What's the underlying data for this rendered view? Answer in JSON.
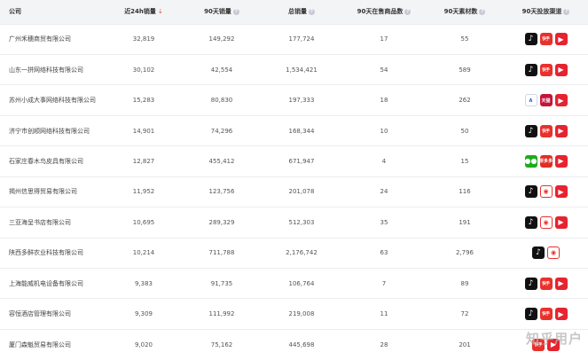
{
  "table": {
    "headers": [
      "公司",
      "近24h销量",
      "90天销量",
      "总销量",
      "90天在售商品数",
      "90天素材数",
      "90天投放渠道"
    ],
    "rows": [
      {
        "company": "广州禾穗商贸有限公司",
        "sales_24h": "32,819",
        "sales_90d": "149,292",
        "sales_total": "177,724",
        "items_90d": "17",
        "materials_90d": "55",
        "channels": [
          "douyin",
          "kuaishou",
          "kuaibao"
        ]
      },
      {
        "company": "山东一拼网络科技有限公司",
        "sales_24h": "30,102",
        "sales_90d": "42,554",
        "sales_total": "1,534,421",
        "items_90d": "54",
        "materials_90d": "589",
        "channels": [
          "douyin",
          "kuaishou",
          "kuaibao"
        ]
      },
      {
        "company": "苏州小成大事网络科技有限公司",
        "sales_24h": "15,283",
        "sales_90d": "80,830",
        "sales_total": "197,333",
        "items_90d": "18",
        "materials_90d": "262",
        "channels": [
          "lvye",
          "tmall",
          "kuaibao"
        ]
      },
      {
        "company": "济宁市创顺网络科技有限公司",
        "sales_24h": "14,901",
        "sales_90d": "74,296",
        "sales_total": "168,344",
        "items_90d": "10",
        "materials_90d": "50",
        "channels": [
          "douyin",
          "kuaishou",
          "kuaibao"
        ]
      },
      {
        "company": "石家庄春木鸟皮具有限公司",
        "sales_24h": "12,827",
        "sales_90d": "455,412",
        "sales_total": "671,947",
        "items_90d": "4",
        "materials_90d": "15",
        "channels": [
          "wechat",
          "pinduoduo",
          "kuaibao"
        ]
      },
      {
        "company": "揭州信思得贸易有限公司",
        "sales_24h": "11,952",
        "sales_90d": "123,756",
        "sales_total": "201,078",
        "items_90d": "24",
        "materials_90d": "116",
        "channels": [
          "douyin",
          "yangtao",
          "kuaibao"
        ]
      },
      {
        "company": "三亚海呈书店有限公司",
        "sales_24h": "10,695",
        "sales_90d": "289,329",
        "sales_total": "512,303",
        "items_90d": "35",
        "materials_90d": "191",
        "channels": [
          "douyin",
          "yangtao",
          "kuaibao"
        ]
      },
      {
        "company": "陕西多鲜农业科技有限公司",
        "sales_24h": "10,214",
        "sales_90d": "711,788",
        "sales_total": "2,176,742",
        "items_90d": "63",
        "materials_90d": "2,796",
        "channels": [
          "douyin",
          "yangtao"
        ]
      },
      {
        "company": "上海能威机电设备有限公司",
        "sales_24h": "9,383",
        "sales_90d": "91,735",
        "sales_total": "106,764",
        "items_90d": "7",
        "materials_90d": "89",
        "channels": [
          "douyin",
          "kuaishou",
          "kuaibao"
        ]
      },
      {
        "company": "容恒酒店管理有限公司",
        "sales_24h": "9,309",
        "sales_90d": "111,992",
        "sales_total": "219,008",
        "items_90d": "11",
        "materials_90d": "72",
        "channels": [
          "douyin",
          "kuaishou",
          "kuaibao"
        ]
      },
      {
        "company": "厦门森魁贸易有限公司",
        "sales_24h": "9,020",
        "sales_90d": "75,162",
        "sales_total": "445,698",
        "items_90d": "28",
        "materials_90d": "201",
        "channels": [
          "kuaishou",
          "kuaibao"
        ]
      }
    ]
  },
  "channel_icons": {
    "douyin": {
      "icon": "douyin-icon",
      "glyph": "♪"
    },
    "kuaishou": {
      "icon": "kuaishou-icon",
      "glyph": "快手"
    },
    "kuaibao": {
      "icon": "kuaibao-icon",
      "glyph": "▶"
    },
    "yangtao": {
      "icon": "yangtao-icon",
      "glyph": "◉"
    },
    "wechat": {
      "icon": "wechat-icon",
      "glyph": "●●"
    },
    "pinduoduo": {
      "icon": "pinduoduo-icon",
      "glyph": "拼多多"
    },
    "lvye": {
      "icon": "lvye-icon",
      "glyph": "∧"
    },
    "tmall": {
      "icon": "tmall-icon",
      "glyph": "天猫"
    }
  },
  "watermark": "知乎用户",
  "colors": {
    "header_bg": "#f3f4f6",
    "sort_arrow": "#e05a5a",
    "row_border": "#ebedf0"
  }
}
